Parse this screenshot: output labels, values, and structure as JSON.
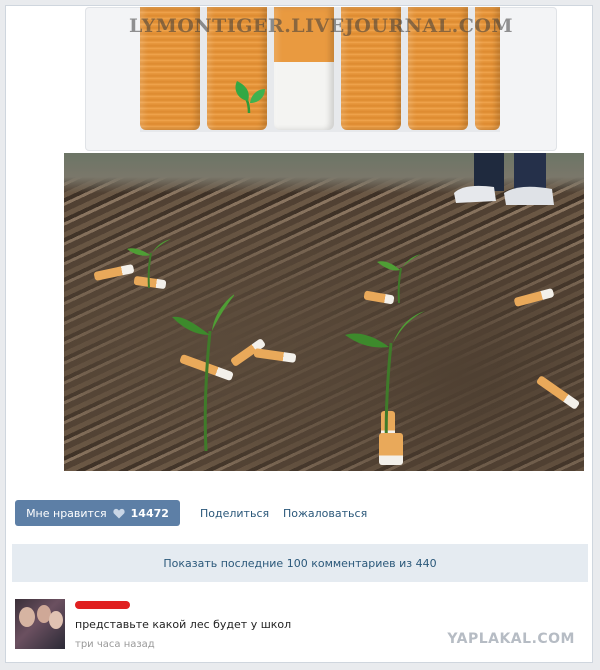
{
  "post": {
    "top_watermark": "LYMONTIGER.LIVEJOURNAL.COM"
  },
  "actions": {
    "like_label": "Мне нравится",
    "like_count": "14472",
    "share_label": "Поделиться",
    "report_label": "Пожаловаться"
  },
  "comments_bar": {
    "label": "Показать последние 100 комментариев из 440"
  },
  "comment": {
    "text": "представьте какой лес будет у школ",
    "time": "три часа назад"
  },
  "site_watermark": "YAPLAKAL.COM",
  "icons": {
    "like": "heart-icon",
    "filter_leaf": "leaf-icon"
  },
  "colors": {
    "like_button": "#5d7fa6",
    "link": "#2b587a",
    "comments_bar": "#e5ebf1",
    "redaction": "#e02020"
  }
}
